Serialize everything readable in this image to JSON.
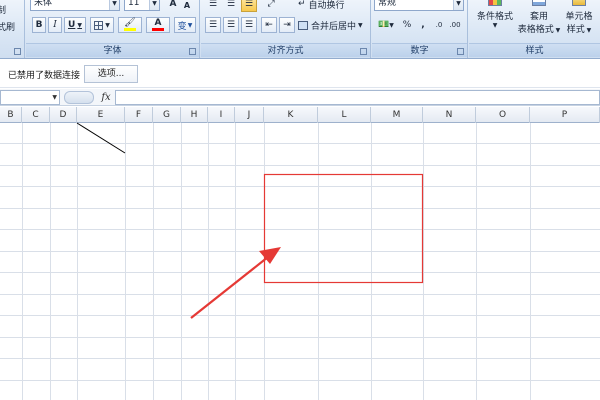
{
  "ribbon": {
    "clipboard": {
      "copy_label": "复制",
      "painter_label": "格式刷"
    },
    "font": {
      "font_name": "宋体",
      "font_size": "11",
      "grow_label": "A",
      "shrink_label": "A",
      "bold": "B",
      "italic": "I",
      "underline": "U",
      "font_color_glyph": "A",
      "phonetic": "变",
      "group_label": "字体",
      "fill_color": "#ffff00",
      "font_color": "#ff0000"
    },
    "alignment": {
      "wrap_label": "自动换行",
      "merge_label": "合并后居中",
      "group_label": "对齐方式"
    },
    "number": {
      "format_value": "常规",
      "percent": "%",
      "comma": ",",
      "group_label": "数字"
    },
    "styles": {
      "conditional_format_label": "条件格式",
      "table_format_line1": "套用",
      "table_format_line2": "表格格式",
      "cell_style_line1": "单元格",
      "cell_style_line2": "样式",
      "group_label": "样式"
    }
  },
  "infobar": {
    "message": "已禁用了数据连接",
    "options_label": "选项..."
  },
  "formula_bar": {
    "fx_label": "fx",
    "name_value": "",
    "formula_value": ""
  },
  "columns": [
    "B",
    "C",
    "D",
    "E",
    "F",
    "G",
    "H",
    "I",
    "J",
    "K",
    "L",
    "M",
    "N",
    "O",
    "P"
  ],
  "annotations": {
    "highlight_color": "#e53935",
    "arrow_color": "#e53935",
    "line_color": "#000000"
  }
}
